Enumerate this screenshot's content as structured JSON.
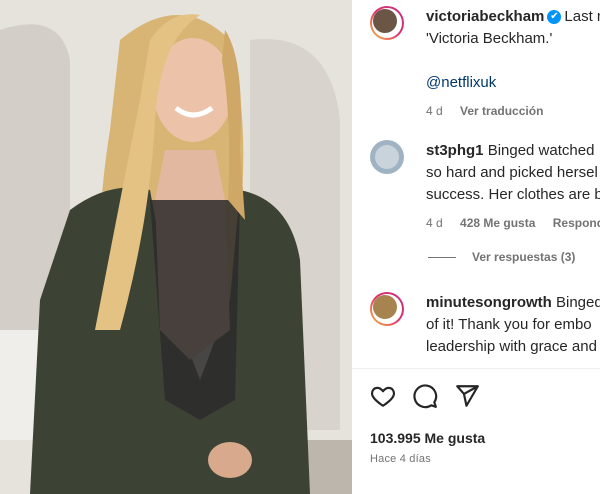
{
  "caption": {
    "username": "victoriabeckham",
    "verified": "✔",
    "text_line1": "Last n",
    "text_line2": "'Victoria Beckham.'",
    "mention": "@netflixuk",
    "age": "4 d",
    "translate": "Ver traducción"
  },
  "comments": [
    {
      "username": "st3phg1",
      "line1": "Binged watched",
      "line2": "so hard and picked hersel",
      "line3": "success. Her clothes are b",
      "age": "4 d",
      "likes": "428 Me gusta",
      "reply": "Responde"
    },
    {
      "username": "minutesongrowth",
      "line1": "Binged",
      "line2": "of it! Thank you for embo",
      "line3": "leadership with grace and"
    }
  ],
  "replies": {
    "label": "Ver respuestas (3)"
  },
  "actions": {
    "like_icon": "heart-icon",
    "comment_icon": "comment-icon",
    "share_icon": "share-icon"
  },
  "post": {
    "likes": "103.995 Me gusta",
    "time": "Hace 4 días"
  },
  "colors": {
    "accent": "#0095f6",
    "muted": "#737373",
    "link": "#00376b"
  }
}
